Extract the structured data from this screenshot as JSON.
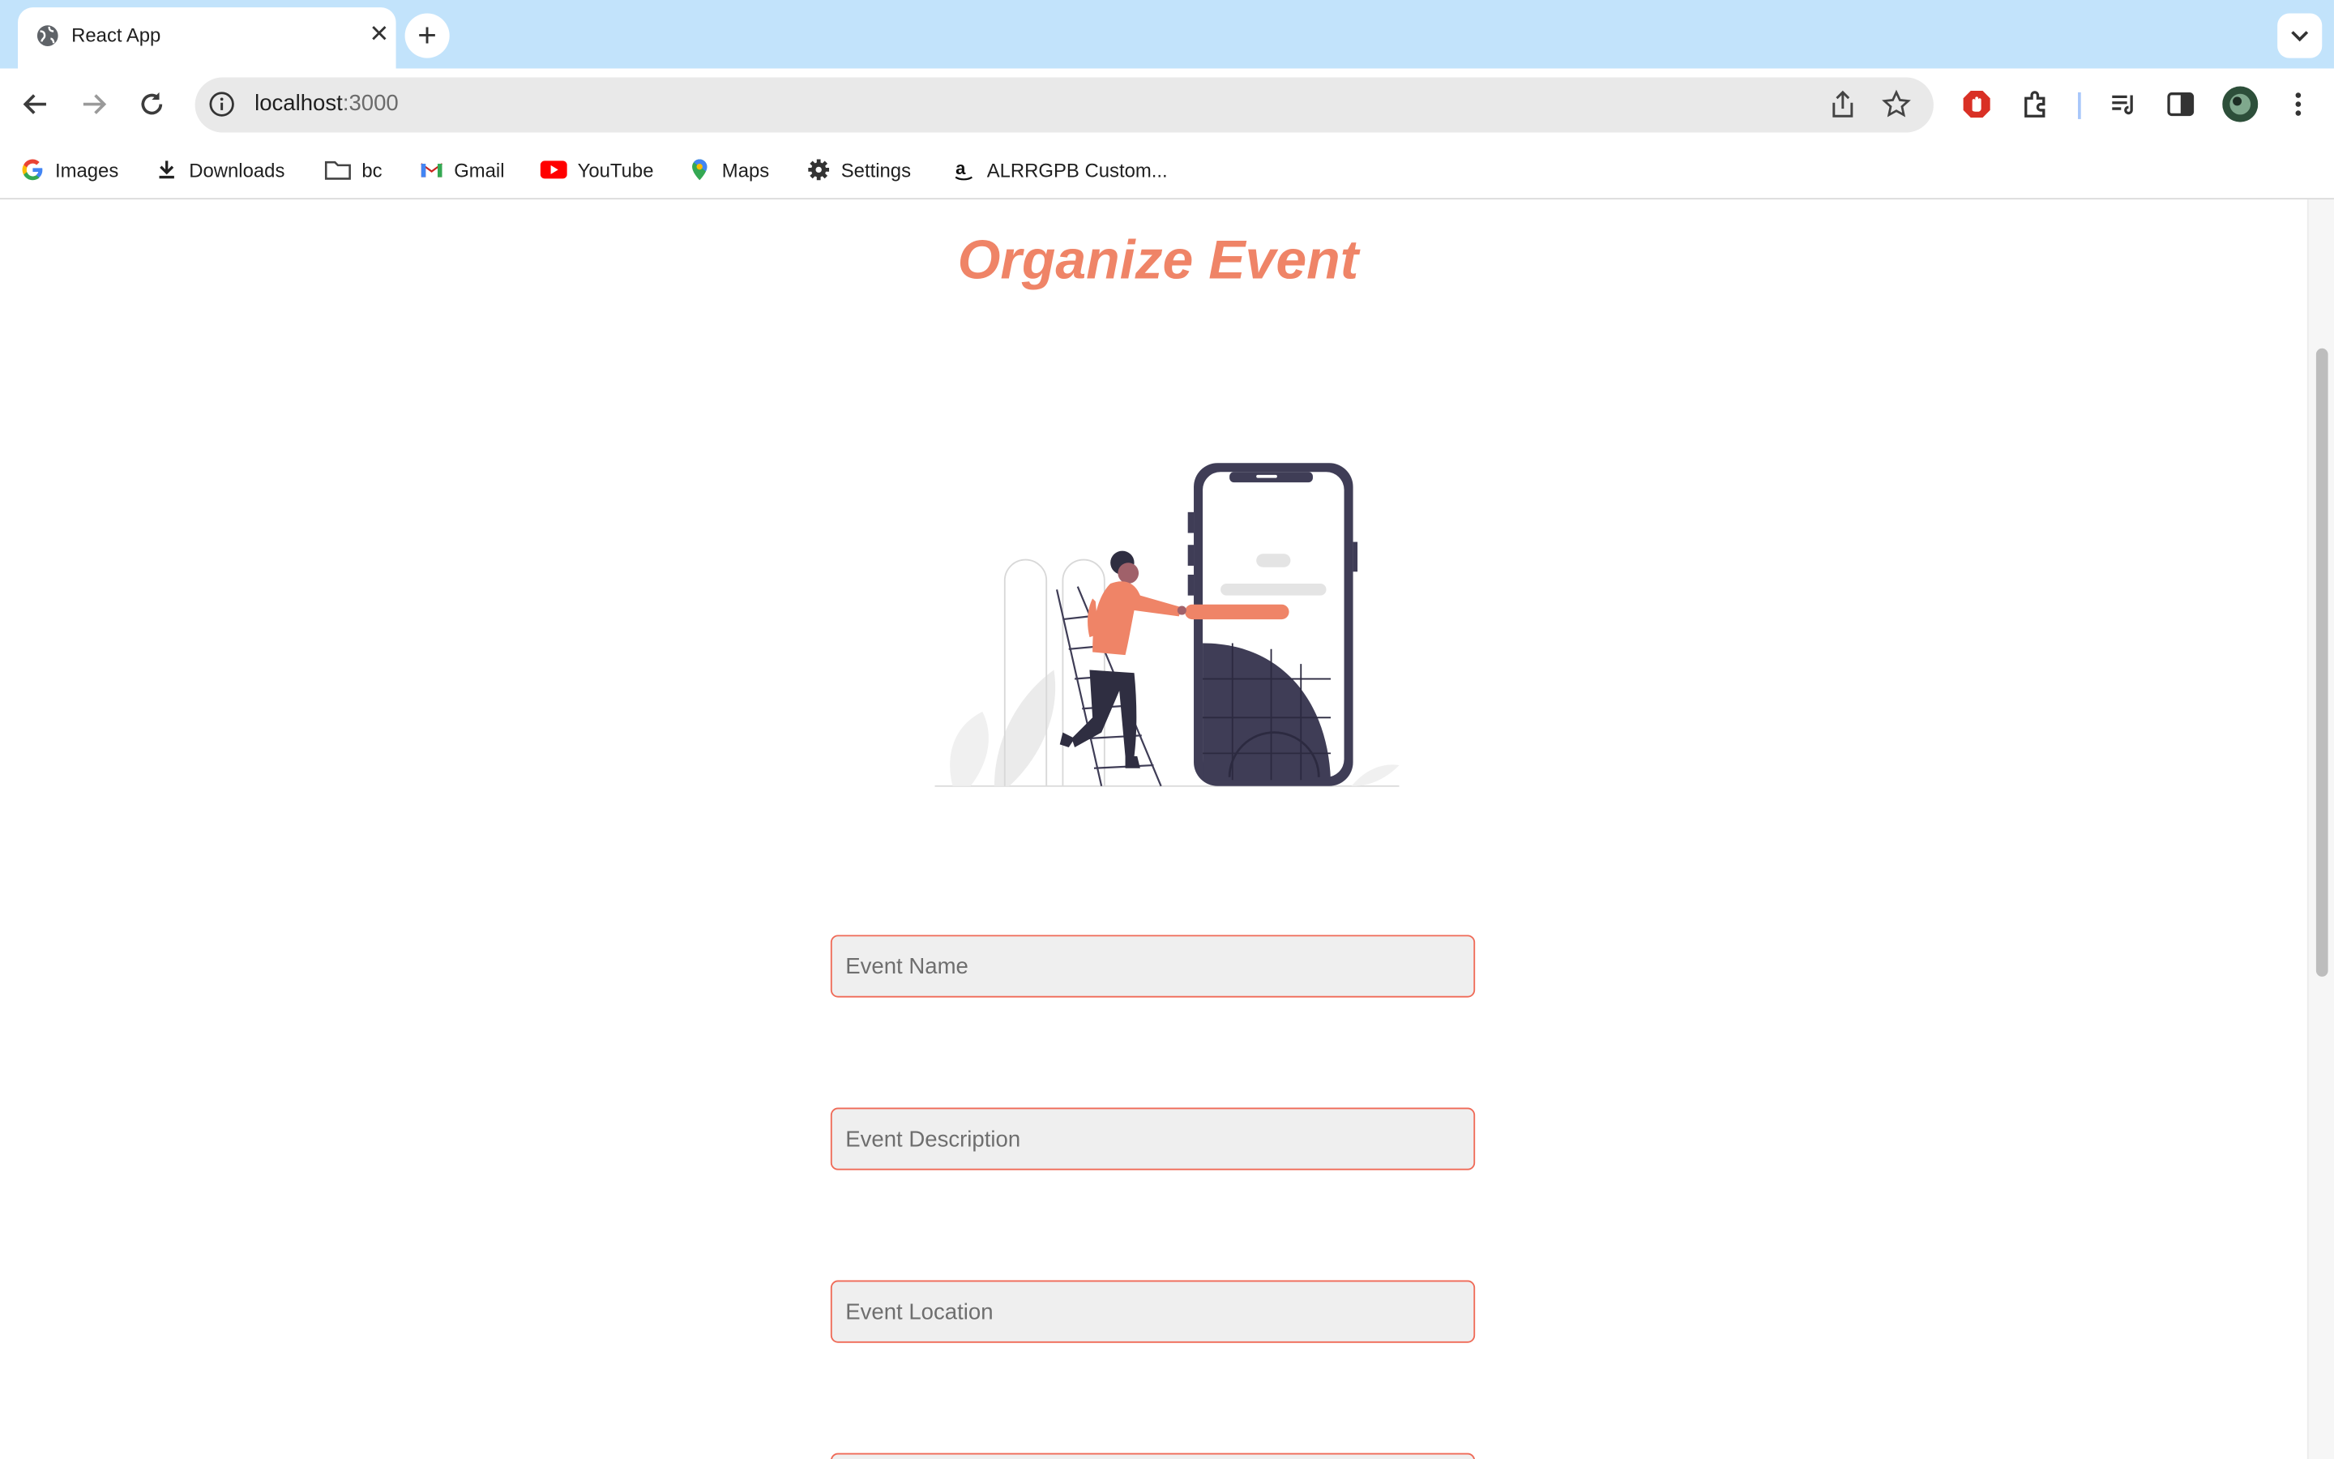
{
  "browser": {
    "tab_title": "React App",
    "new_tab_symbol": "+",
    "url_host": "localhost",
    "url_port": ":3000",
    "bookmarks": [
      {
        "label": "Images",
        "icon": "google-icon"
      },
      {
        "label": "Downloads",
        "icon": "download-icon"
      },
      {
        "label": "bc",
        "icon": "folder-icon"
      },
      {
        "label": "Gmail",
        "icon": "gmail-icon"
      },
      {
        "label": "YouTube",
        "icon": "youtube-icon"
      },
      {
        "label": "Maps",
        "icon": "maps-icon"
      },
      {
        "label": "Settings",
        "icon": "gear-icon"
      },
      {
        "label": "ALRRGPB Custom...",
        "icon": "amazon-icon"
      }
    ]
  },
  "page": {
    "heading": "Organize Event",
    "fields": {
      "event_name_placeholder": "Event Name",
      "event_description_placeholder": "Event Description",
      "event_location_placeholder": "Event Location"
    }
  },
  "colors": {
    "accent": "#ef8467",
    "field_border": "#ef6a57",
    "tab_strip": "#c2e3fb",
    "illustration_dark": "#3f3d56"
  }
}
